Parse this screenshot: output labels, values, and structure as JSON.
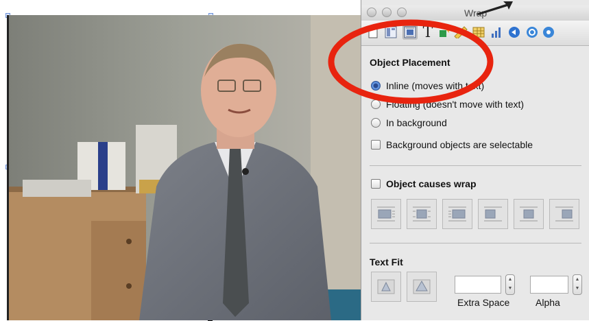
{
  "window": {
    "title": "Wrap"
  },
  "toolbar": {
    "tools": [
      {
        "icon": "document-icon"
      },
      {
        "icon": "layout-icon"
      },
      {
        "icon": "wrap-icon",
        "selected": true
      },
      {
        "icon": "text-icon",
        "glyph": "T"
      },
      {
        "icon": "graphic-icon"
      },
      {
        "icon": "metrics-ruler-icon"
      },
      {
        "icon": "table-icon"
      },
      {
        "icon": "chart-icon"
      },
      {
        "icon": "hyperlink-icon"
      },
      {
        "icon": "quicktime-icon"
      }
    ]
  },
  "object_placement": {
    "title": "Object Placement",
    "options": [
      {
        "label": "Inline (moves with text)",
        "selected": true
      },
      {
        "label": "Floating (doesn't move with text)",
        "selected": false
      },
      {
        "label": "In background",
        "selected": false
      }
    ],
    "background_selectable_label": "Background objects are selectable"
  },
  "wrap": {
    "object_causes_wrap_label": "Object causes wrap",
    "styles": [
      {
        "icon": "wrap-left-icon"
      },
      {
        "icon": "wrap-both-icon"
      },
      {
        "icon": "wrap-right-icon"
      },
      {
        "icon": "wrap-top-left-icon"
      },
      {
        "icon": "wrap-top-center-icon"
      },
      {
        "icon": "wrap-top-right-icon"
      }
    ]
  },
  "text_fit": {
    "title": "Text Fit",
    "extra_space_label": "Extra Space",
    "alpha_label": "Alpha",
    "extra_space_value": "",
    "alpha_value": ""
  },
  "colors": {
    "annotation_red": "#e8240f",
    "radio_selected": "#3d6fc4",
    "panel_bg": "#e8e8e8"
  }
}
